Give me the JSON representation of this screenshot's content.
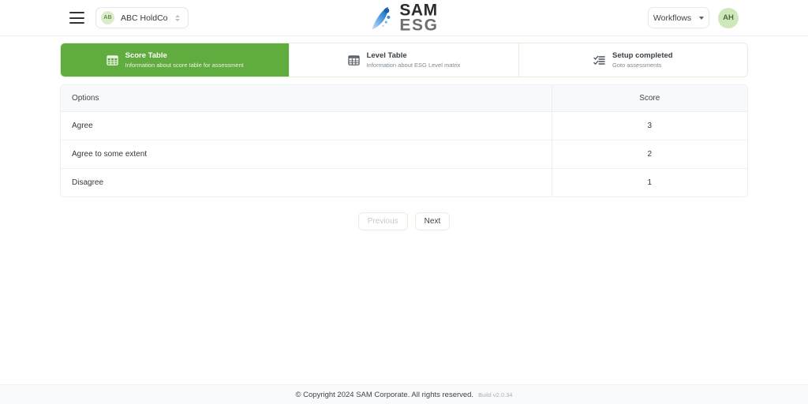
{
  "topbar": {
    "menu_icon": "hamburger-icon",
    "company": {
      "initials": "AB",
      "name": "ABC HoldCo",
      "selector_icon": "chevron-updown-icon"
    },
    "logo": {
      "primary": "SAM",
      "secondary": "ESG",
      "mark_icon": "sam-swoosh-logo-icon"
    },
    "workflows": {
      "label": "Workflows",
      "chevron_icon": "chevron-down-icon"
    },
    "avatar_initials": "AH"
  },
  "tabs": [
    {
      "title": "Score Table",
      "subtitle": "Information about score table for assessment",
      "icon": "table-grid-icon",
      "active": true
    },
    {
      "title": "Level Table",
      "subtitle": "Information about ESG Level matrix",
      "icon": "table-grid-icon",
      "active": false
    },
    {
      "title": "Setup completed",
      "subtitle": "Goto assessments",
      "icon": "checklist-icon",
      "active": false
    }
  ],
  "table": {
    "columns": [
      "Options",
      "Score"
    ],
    "rows": [
      {
        "option": "Agree",
        "score": "3"
      },
      {
        "option": "Agree to some extent",
        "score": "2"
      },
      {
        "option": "Disagree",
        "score": "1"
      }
    ]
  },
  "pager": {
    "previous_label": "Previous",
    "next_label": "Next"
  },
  "footer": {
    "copyright": "© Copyright 2024 SAM Corporate. All rights reserved.",
    "build": "Build v2.0.34"
  },
  "colors": {
    "accent_green": "#61ac3f",
    "badge_green": "#d8edc8",
    "avatar_green": "#cfe8bb",
    "header_gray": "#f8f9fb",
    "border": "#eceff1",
    "logo_blue": "#2f7fd4"
  }
}
